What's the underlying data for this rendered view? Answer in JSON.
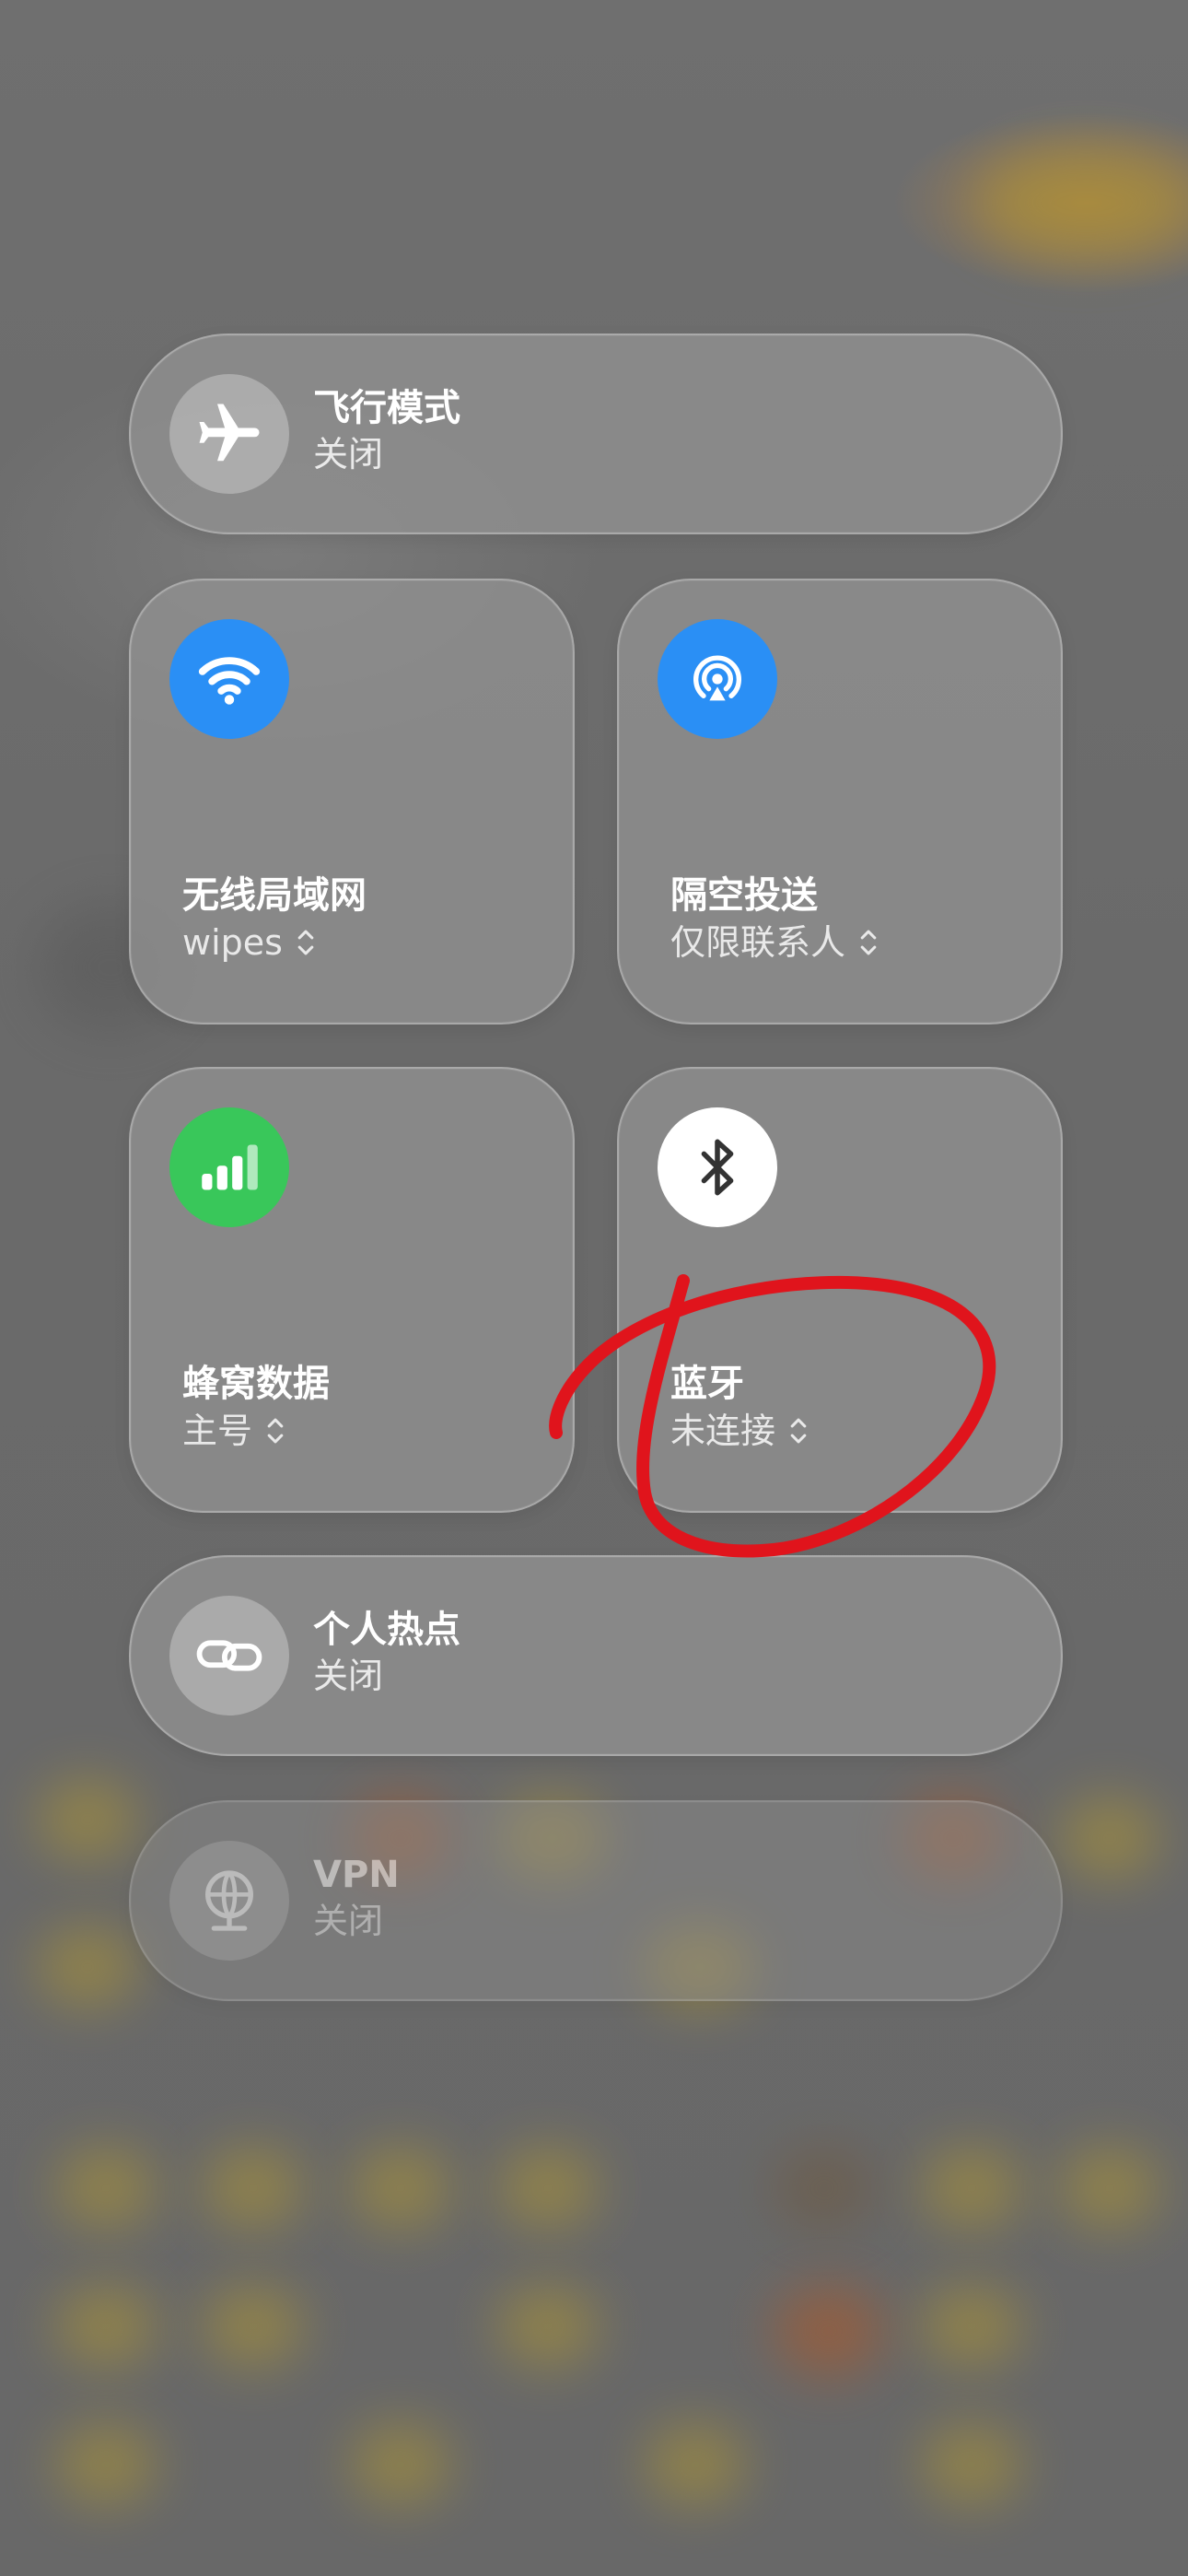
{
  "controls": {
    "airplane": {
      "title": "飞行模式",
      "status": "关闭",
      "icon": "airplane-icon"
    },
    "wifi": {
      "title": "无线局域网",
      "status": "wipes",
      "icon": "wifi-icon",
      "color": "#2a8ff5"
    },
    "airdrop": {
      "title": "隔空投送",
      "status": "仅限联系人",
      "icon": "airdrop-icon",
      "color": "#2a8ff5"
    },
    "cellular": {
      "title": "蜂窝数据",
      "status": "主号",
      "icon": "cellular-icon",
      "color": "#39c75a"
    },
    "bluetooth": {
      "title": "蓝牙",
      "status": "未连接",
      "icon": "bluetooth-icon",
      "color": "#ffffff"
    },
    "hotspot": {
      "title": "个人热点",
      "status": "关闭",
      "icon": "hotspot-link-icon"
    },
    "vpn": {
      "title": "VPN",
      "status": "关闭",
      "icon": "vpn-globe-icon"
    }
  },
  "annotation": {
    "color": "#e0141c",
    "shape": "hand-drawn-circle"
  }
}
